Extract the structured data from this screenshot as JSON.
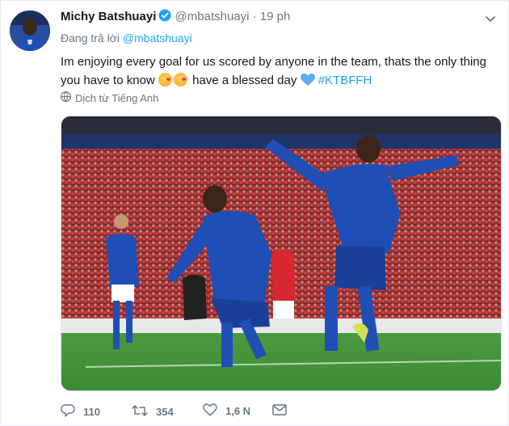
{
  "tweet": {
    "author_name": "Michy Batshuayi",
    "handle": "@mbatshuayi",
    "separator": "·",
    "time": "19 ph",
    "reply_prefix": "Đang trả lời",
    "reply_to": "@mbatshuayi",
    "text_part1": "Im enjoying every goal for us scored by anyone in the team, thats the only thing you have to know",
    "text_part2": "have a blessed day",
    "hashtag": "#KTBFFH",
    "translate_label": "Dịch từ Tiếng Anh"
  },
  "actions": {
    "reply_count": "110",
    "retweet_count": "354",
    "like_count": "1,6 N"
  },
  "icons": [
    "verified-icon",
    "caret-down-icon",
    "globe-icon",
    "reply-icon",
    "retweet-icon",
    "like-icon",
    "message-icon",
    "blue-heart-icon",
    "kissing-face-icon"
  ],
  "colors": {
    "accent": "#1da1f2",
    "muted": "#657786",
    "chelsea_blue": "#1f4fb4"
  }
}
